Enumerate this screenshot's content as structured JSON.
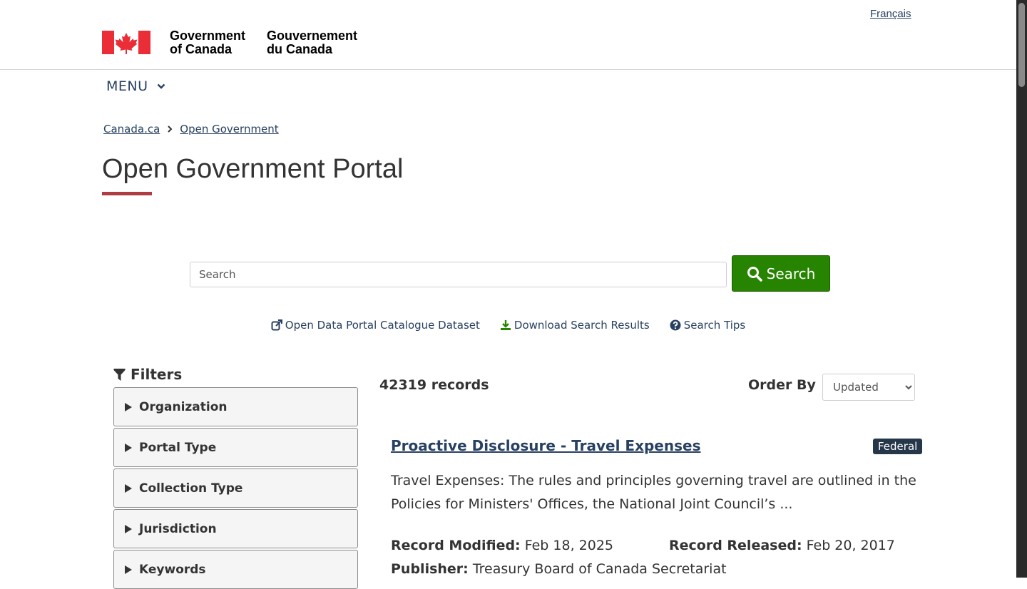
{
  "header": {
    "language_link": "Français",
    "signature_en_line1": "Government",
    "signature_en_line2": "of Canada",
    "signature_fr_line1": "Gouvernement",
    "signature_fr_line2": "du Canada",
    "flag_color": "#eb2d37"
  },
  "menu": {
    "label": "MENU"
  },
  "breadcrumb": [
    "Canada.ca",
    "Open Government"
  ],
  "page": {
    "title": "Open Government Portal",
    "accent_color": "#af3c43"
  },
  "search": {
    "placeholder": "Search",
    "value": "",
    "button_label": "Search",
    "button_color": "#278400"
  },
  "links": {
    "catalogue": "Open Data Portal Catalogue Dataset",
    "download": "Download Search Results",
    "tips": "Search Tips"
  },
  "filters": {
    "title": "Filters",
    "items": [
      "Organization",
      "Portal Type",
      "Collection Type",
      "Jurisdiction",
      "Keywords"
    ]
  },
  "results": {
    "count": "42319 records",
    "order_label": "Order By",
    "order_selected": "Updated",
    "first": {
      "title": "Proactive Disclosure - Travel Expenses",
      "badge": "Federal",
      "description": "Travel Expenses: The rules and principles governing travel are outlined in the Policies for Ministers' Offices, the National Joint Council’s ...",
      "modified_label": "Record Modified:",
      "modified_value": "Feb 18, 2025",
      "released_label": "Record Released:",
      "released_value": "Feb 20, 2017",
      "publisher_label": "Publisher:",
      "publisher_value": "Treasury Board of Canada Secretariat"
    }
  }
}
